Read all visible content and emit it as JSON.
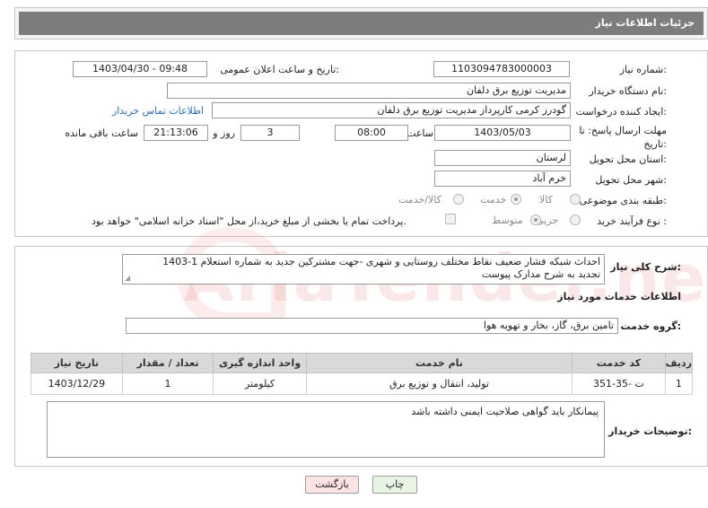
{
  "header": {
    "title": "جزئیات اطلاعات نیاز"
  },
  "form": {
    "need_number_label": "شماره نیاز:",
    "need_number": "1103094783000003",
    "announce_label": "تاریخ و ساعت اعلان عمومی:",
    "announce_value": "1403/04/30 - 09:48",
    "buyer_org_label": "نام دستگاه خریدار:",
    "buyer_org": "مدیریت توزیع برق دلفان",
    "creator_label": "ایجاد کننده درخواست:",
    "creator": "گودرز کرمی کارپرداز مدیریت توزیع برق دلفان",
    "contact_link": "اطلاعات تماس خریدار",
    "deadline_label": "مهلت ارسال پاسخ: تا تاریخ:",
    "deadline_date": "1403/05/03",
    "time_label": "ساعت",
    "deadline_time": "08:00",
    "days_value": "3",
    "days_label": "روز و",
    "remaining_time": "21:13:06",
    "remaining_label": "ساعت باقی مانده",
    "province_label": "استان محل تحویل:",
    "province": "لرستان",
    "city_label": "شهر محل تحویل:",
    "city": "خرم آباد",
    "category_label": "طبقه بندی موضوعی:",
    "category_options": [
      "کالا",
      "خدمت",
      "کالا/خدمت"
    ],
    "category_selected": "خدمت",
    "process_label": "نوع فرآیند خرید :",
    "process_options": [
      "جزیی",
      "متوسط"
    ],
    "process_selected": "متوسط",
    "payment_note": "پرداخت تمام یا بخشی از مبلغ خرید،از محل \"اسناد خزانه اسلامی\" خواهد بود."
  },
  "description": {
    "label": "شرح کلی نیاز:",
    "text_line1": "احداث شبکه فشار ضعیف نقاط مختلف روستایی و شهری -جهت مشترکین جدید به شماره استعلام 1-1403",
    "text_line2": "تجدید به شرح مدارک پیوست"
  },
  "services": {
    "section_title": "اطلاعات خدمات مورد نیاز",
    "group_label": "گروه خدمت:",
    "group_value": "تامین برق، گاز، بخار و تهویه هوا",
    "columns": [
      "ردیف",
      "کد خدمت",
      "نام خدمت",
      "واحد اندازه گیری",
      "تعداد / مقدار",
      "تاریخ نیاز"
    ],
    "rows": [
      {
        "index": "1",
        "code": "ت -35-351",
        "name": "تولید، انتقال و توزیع برق",
        "unit": "کیلومتر",
        "qty": "1",
        "date": "1403/12/29"
      }
    ]
  },
  "buyer_notes": {
    "label": "توضیحات خریدار:",
    "text": "پیمانکار باید گواهی صلاحیت ایمنی داشته باشد"
  },
  "buttons": {
    "print": "چاپ",
    "back": "بازگشت"
  },
  "colors": {
    "header_bg": "#7d7d7d",
    "link": "#2a6ebb",
    "back_button_bg": "#fde4e4",
    "print_button_bg": "#e9f5e4"
  }
}
